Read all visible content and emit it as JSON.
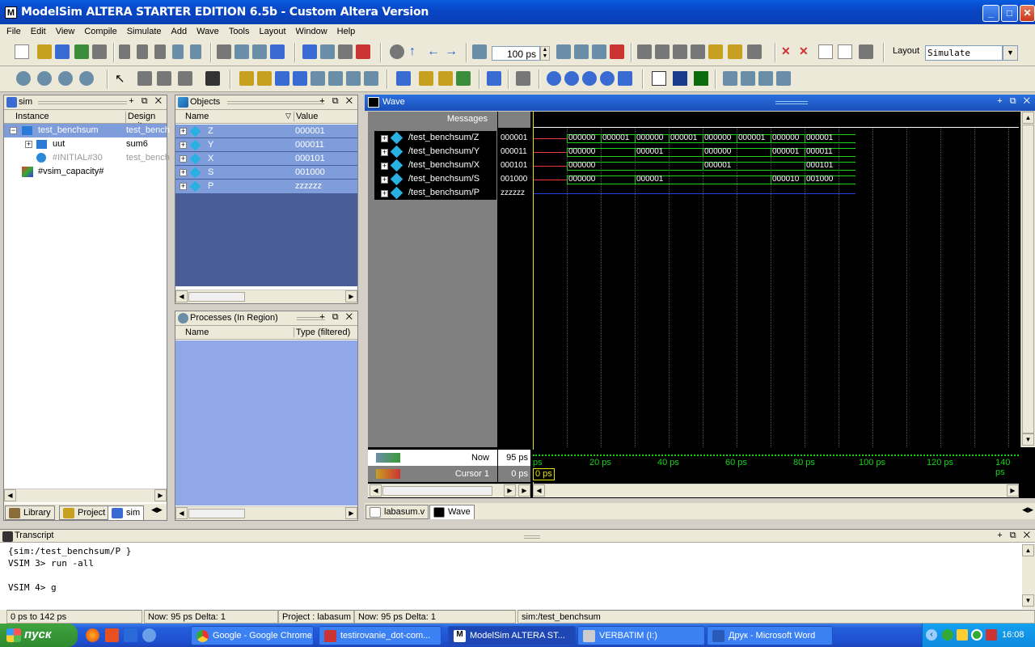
{
  "window": {
    "title": "ModelSim ALTERA STARTER EDITION 6.5b - Custom Altera Version",
    "minimize": "_",
    "maximize": "□",
    "close": "✕"
  },
  "menu": [
    "File",
    "Edit",
    "View",
    "Compile",
    "Simulate",
    "Add",
    "Wave",
    "Tools",
    "Layout",
    "Window",
    "Help"
  ],
  "toolbar": {
    "run_length": "100 ps",
    "layout_label": "Layout",
    "layout_value": "Simulate"
  },
  "sim_pane": {
    "title": "sim",
    "col_instance": "Instance",
    "col_design_unit": "Design unit",
    "rows": [
      {
        "name": "test_benchsum",
        "unit": "test_bench",
        "level": 0,
        "selected": true
      },
      {
        "name": "uut",
        "unit": "sum6",
        "level": 1,
        "selected": false
      },
      {
        "name": "#INITIAL#30",
        "unit": "test_bench",
        "level": 1,
        "selected": false
      },
      {
        "name": "#vsim_capacity#",
        "unit": "",
        "level": 0,
        "selected": false
      }
    ],
    "tabs": [
      "Library",
      "Project",
      "sim"
    ]
  },
  "objects_pane": {
    "title": "Objects",
    "col_name": "Name",
    "col_value": "Value",
    "rows": [
      {
        "name": "Z",
        "value": "000001"
      },
      {
        "name": "Y",
        "value": "000011"
      },
      {
        "name": "X",
        "value": "000101"
      },
      {
        "name": "S",
        "value": "001000"
      },
      {
        "name": "P",
        "value": "zzzzzz"
      }
    ]
  },
  "processes_pane": {
    "title": "Processes (In Region)",
    "col_name": "Name",
    "col_type": "Type (filtered)"
  },
  "wave_pane": {
    "title": "Wave",
    "messages_header": "Messages",
    "signals": [
      {
        "name": "/test_benchsum/Z",
        "value": "000001"
      },
      {
        "name": "/test_benchsum/Y",
        "value": "000011"
      },
      {
        "name": "/test_benchsum/X",
        "value": "000101"
      },
      {
        "name": "/test_benchsum/S",
        "value": "001000"
      },
      {
        "name": "/test_benchsum/P",
        "value": "zzzzzz"
      }
    ],
    "bus_values": {
      "Z": [
        "000000",
        "000001",
        "000000",
        "000001",
        "000000",
        "000001",
        "000000",
        "000001"
      ],
      "Y": [
        "000000",
        "000001",
        "000000",
        "000001",
        "000011"
      ],
      "X": [
        "000000",
        "000001",
        "000101"
      ],
      "S": [
        "000000",
        "000001",
        "000010",
        "001000"
      ]
    },
    "now_label": "Now",
    "now_value": "95 ps",
    "cursor_label": "Cursor 1",
    "cursor_value": "0 ps",
    "cursor_flag": "0 ps",
    "ticks": [
      "ps",
      "20 ps",
      "40 ps",
      "60 ps",
      "80 ps",
      "100 ps",
      "120 ps",
      "140 ps"
    ],
    "tabs": [
      "labasum.v",
      "Wave"
    ]
  },
  "transcript": {
    "title": "Transcript",
    "lines": [
      "{sim:/test_benchsum/P }",
      "VSIM 3> run -all",
      "",
      "VSIM 4> g"
    ]
  },
  "statusbar": {
    "range": "0 ps to 142 ps",
    "now_delta": "Now: 95 ps  Delta: 1",
    "project": "Project : labasum",
    "now_delta2": "Now: 95 ps   Delta: 1",
    "context": "sim:/test_benchsum"
  },
  "taskbar": {
    "start": "пуск",
    "buttons": [
      "Google - Google Chrome",
      "testirovanie_dot-com...",
      "ModelSim ALTERA ST...",
      "VERBATIM (I:)",
      "Друк - Microsoft Word"
    ],
    "clock": "16:08"
  },
  "colors": {
    "wave_green": "#19d119",
    "cursor_yellow": "#e5e500",
    "selection": "#7f9ddb"
  }
}
